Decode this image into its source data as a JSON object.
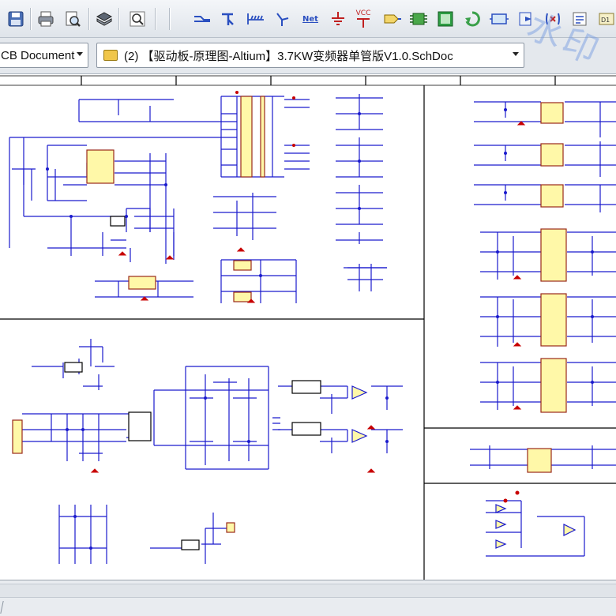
{
  "toolbar": {
    "buttons": [
      {
        "icon": "save-icon"
      },
      {
        "icon": "print-icon"
      },
      {
        "icon": "print-preview-icon"
      },
      {
        "icon": "layer-stack-icon"
      },
      {
        "icon": "zoom-icon"
      },
      {
        "icon": "wire-icon"
      },
      {
        "icon": "bus-icon"
      },
      {
        "icon": "bus-entry-icon"
      },
      {
        "icon": "power-port-icon"
      },
      {
        "icon": "net-label-icon",
        "label": "Net"
      },
      {
        "icon": "gnd-power-port-icon"
      },
      {
        "icon": "vcc-power-port-icon",
        "label": "VCC"
      },
      {
        "icon": "port-icon"
      },
      {
        "icon": "part-icon"
      },
      {
        "icon": "sheet-symbol-icon"
      },
      {
        "icon": "sheet-entry-icon"
      },
      {
        "icon": "device-sheet-icon"
      },
      {
        "icon": "hierarchy-icon"
      },
      {
        "icon": "compile-icon"
      }
    ]
  },
  "document_row": {
    "project_combo": "CB Document",
    "doc_combo": "(2) 【驱动板-原理图-Altium】3.7KW变频器单管版V1.0.SchDoc"
  },
  "watermark": "水印",
  "colors": {
    "wire": "#1a1acd",
    "component_fill": "#fff8a8",
    "component_border": "#9a2a1a",
    "power_red": "#c80000",
    "sheet_border": "#000000"
  }
}
